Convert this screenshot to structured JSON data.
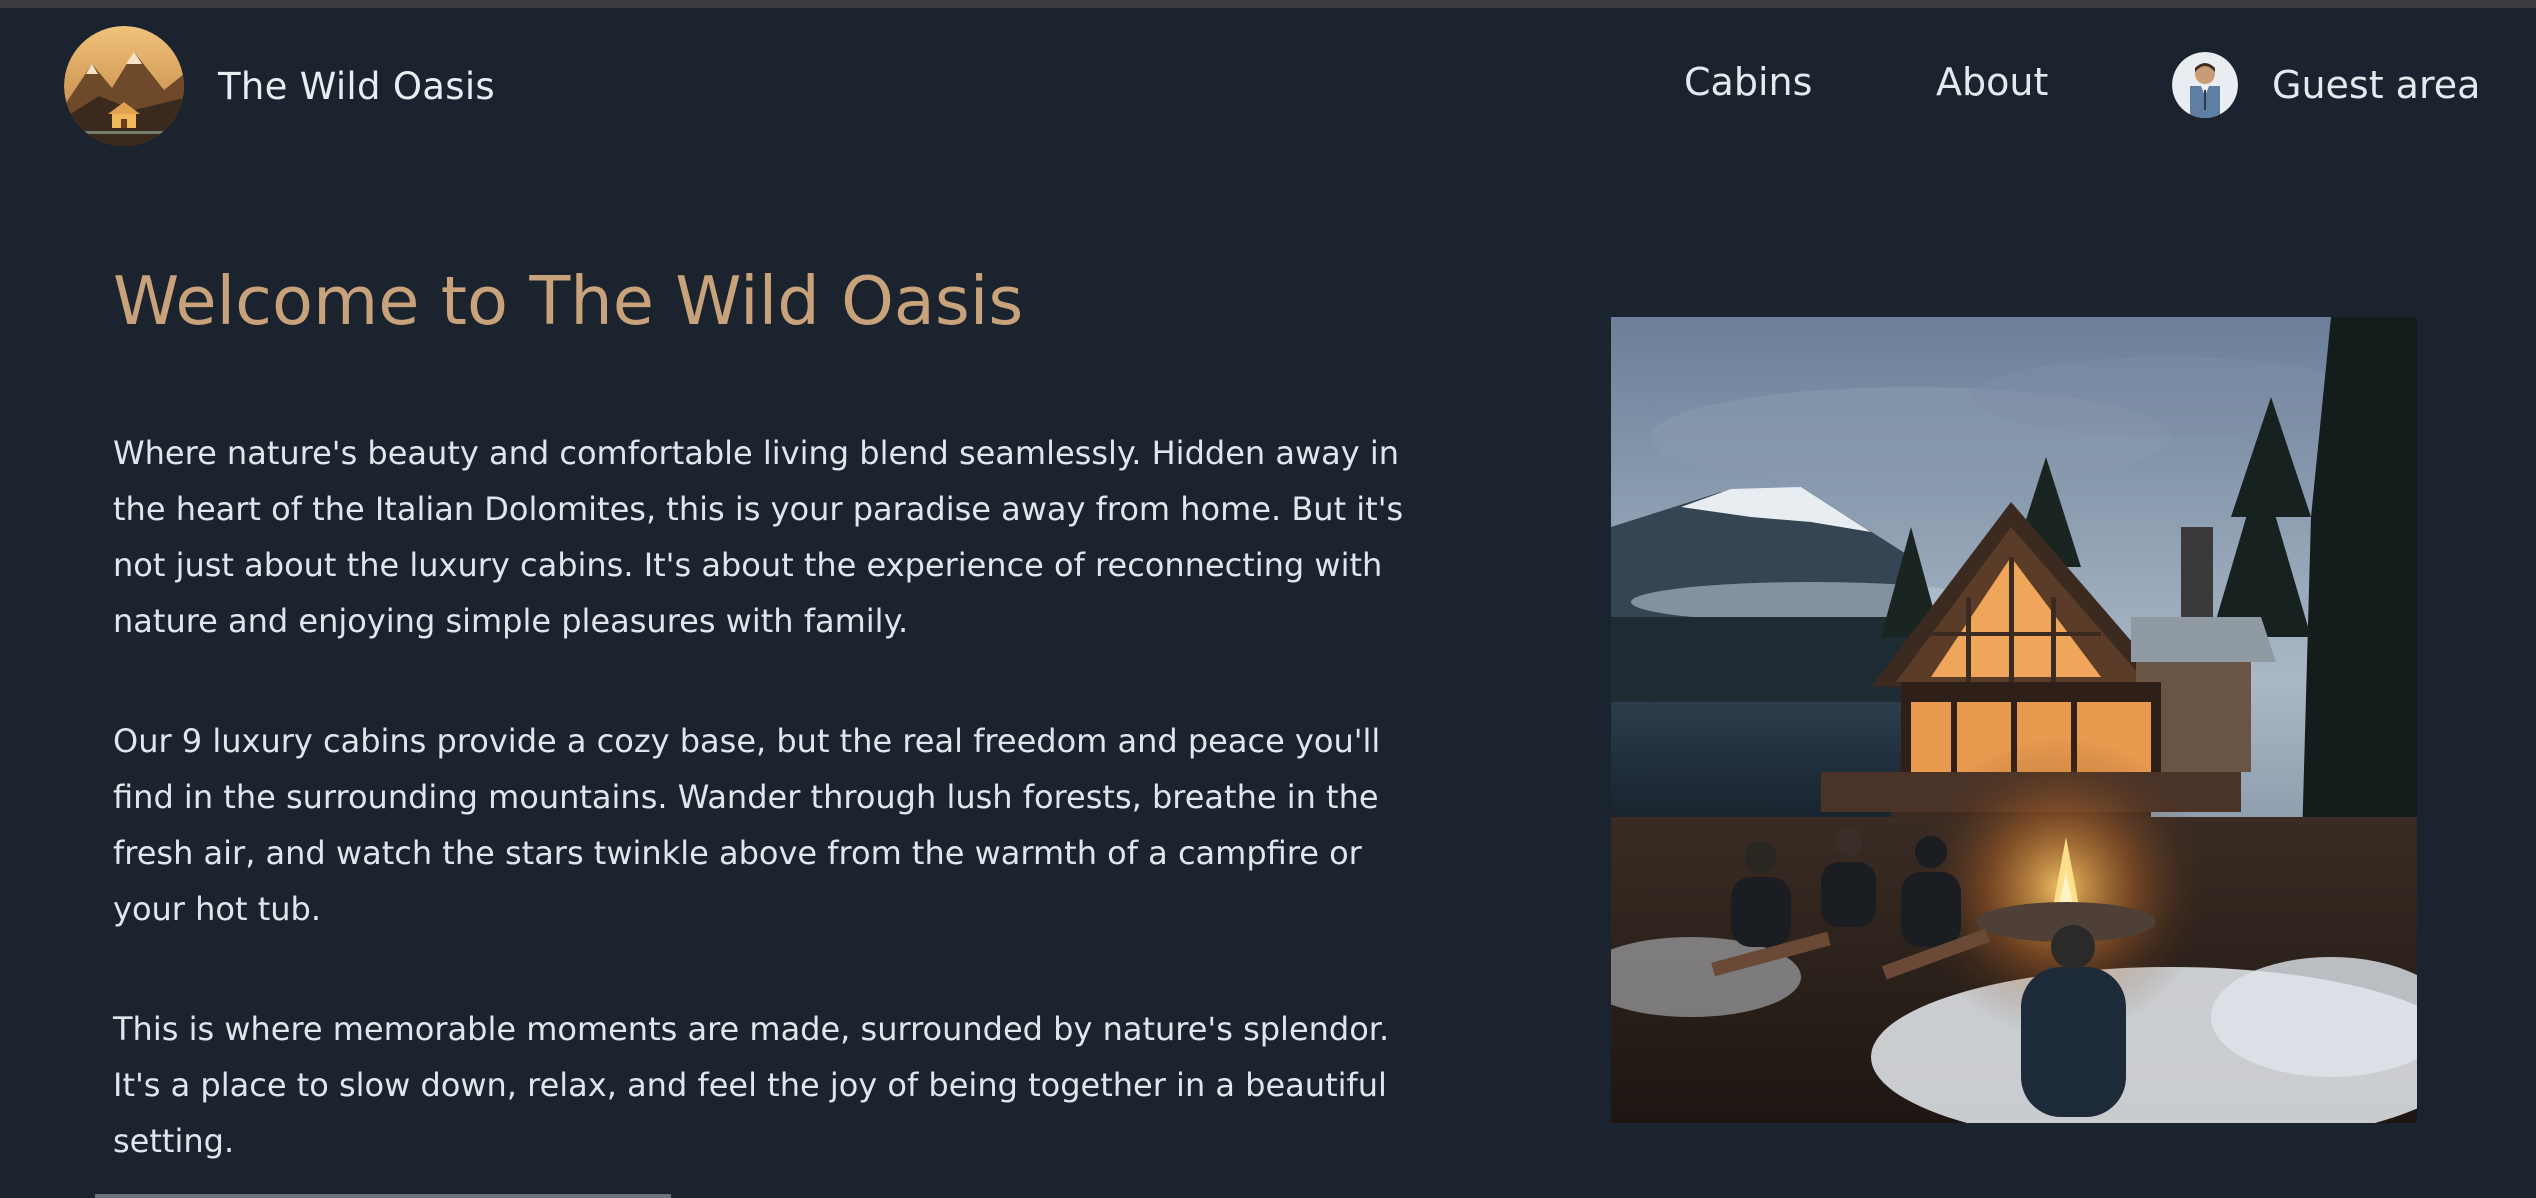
{
  "header": {
    "brand_name": "The Wild Oasis",
    "nav": {
      "cabins": "Cabins",
      "about": "About",
      "guest_area": "Guest area"
    }
  },
  "main": {
    "title": "Welcome to The Wild Oasis",
    "paragraphs": [
      "Where nature's beauty and comfortable living blend seamlessly. Hidden away in the heart of the Italian Dolomites, this is your paradise away from home. But it's not just about the luxury cabins. It's about the experience of reconnecting with nature and enjoying simple pleasures with family.",
      "Our 9 luxury cabins provide a cozy base, but the real freedom and peace you'll find in the surrounding mountains. Wander through lush forests, breathe in the fresh air, and watch the stars twinkle above from the warmth of a campfire or your hot tub.",
      "This is where memorable moments are made, surrounded by nature's splendor. It's a place to slow down, relax, and feel the joy of being together in a beautiful setting."
    ]
  },
  "colors": {
    "background": "#1b232e",
    "accent": "#c7a27a",
    "text": "#e2e6ec"
  },
  "icons": {
    "logo": "mountain-cabin-logo-icon",
    "avatar": "user-avatar-icon",
    "hero": "cabin-campfire-image"
  }
}
